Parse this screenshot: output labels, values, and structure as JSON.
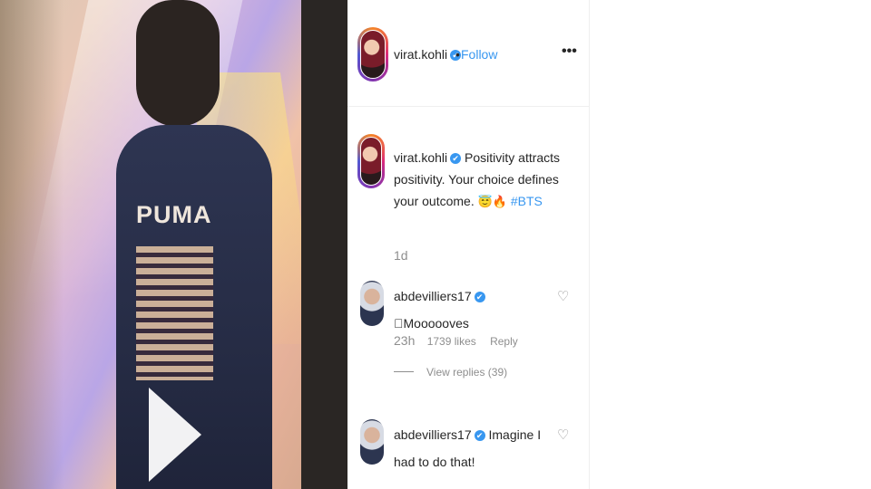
{
  "post": {
    "username": "virat.kohli",
    "verified_glyph": "✔",
    "dot": "•",
    "follow_label": "Follow",
    "more_label": "•••",
    "caption_text": "Positivity attracts positivity. Your choice defines your outcome.",
    "caption_emoji": "😇🔥",
    "hashtag": "#BTS",
    "time_ago": "1d"
  },
  "media": {
    "jersey_text": "PUMA",
    "play_icon": "play-icon"
  },
  "comments": [
    {
      "username": "abdevilliers17",
      "text": "\u0000Moooooves",
      "time": "23h",
      "likes": "1739 likes",
      "reply_label": "Reply",
      "view_replies": "View replies (39)"
    },
    {
      "username": "abdevilliers17",
      "text": "Imagine I had to do that!"
    }
  ],
  "colors": {
    "link_blue": "#3897f0",
    "text": "#262626",
    "muted": "#8e8e8e"
  }
}
